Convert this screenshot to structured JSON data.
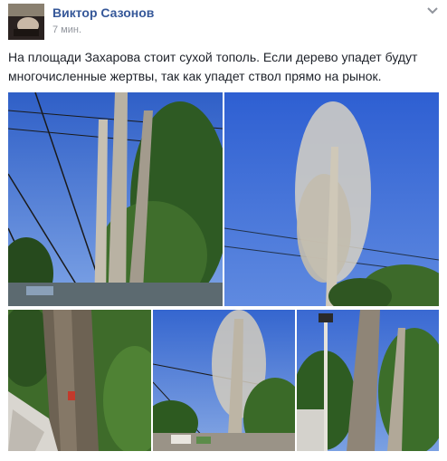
{
  "post": {
    "author": "Виктор Сазонов",
    "time": "7 мин.",
    "text": "На площади Захарова стоит сухой тополь. Если дерево упадет будут многочисленные жертвы, так как упадет ствол прямо на рынок."
  },
  "icons": {
    "options": "chevron-down-icon",
    "avatar": "profile-photo"
  },
  "colors": {
    "author_link": "#365899",
    "timestamp": "#90949c",
    "body_text": "#1d2129",
    "sky": "#3f6fd6"
  },
  "photos": [
    {
      "id": "photo-1",
      "subject": "dry poplar with power lines"
    },
    {
      "id": "photo-2",
      "subject": "dry poplar crown against sky"
    },
    {
      "id": "photo-3",
      "subject": "tree trunk base"
    },
    {
      "id": "photo-4",
      "subject": "poplar over market street"
    },
    {
      "id": "photo-5",
      "subject": "trunk next to street lamp"
    }
  ]
}
